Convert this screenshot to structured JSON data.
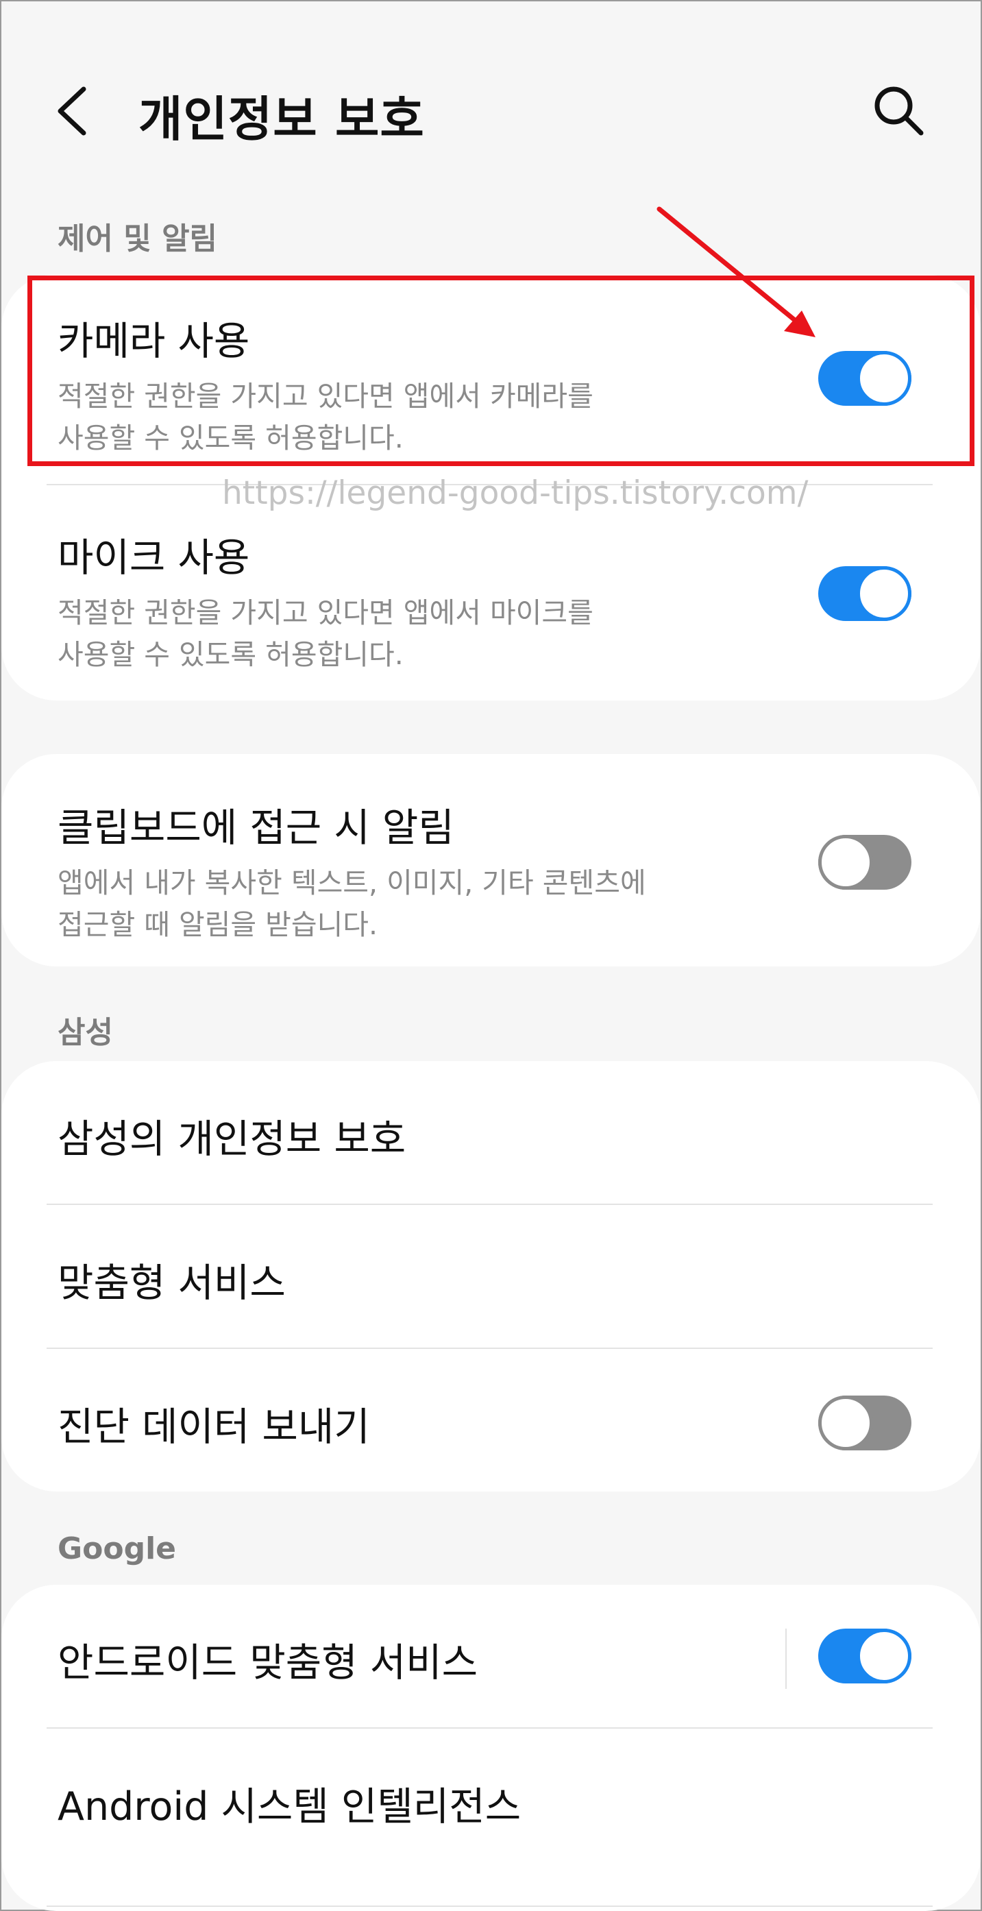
{
  "header": {
    "title": "개인정보 보호",
    "back_icon": "chevron-left-icon",
    "search_icon": "search-icon"
  },
  "sections": {
    "control": {
      "label": "제어 및 알림"
    },
    "samsung": {
      "label": "삼성"
    },
    "google": {
      "label": "Google"
    }
  },
  "items": {
    "camera": {
      "title": "카메라 사용",
      "desc_line1": "적절한 권한을 가지고 있다면 앱에서 카메라를",
      "desc_line2": "사용할 수 있도록 허용합니다.",
      "enabled": true
    },
    "mic": {
      "title": "마이크 사용",
      "desc_line1": "적절한 권한을 가지고 있다면 앱에서 마이크를",
      "desc_line2": "사용할 수 있도록 허용합니다.",
      "enabled": true
    },
    "clipboard": {
      "title": "클립보드에 접근 시 알림",
      "desc_line1": "앱에서 내가 복사한 텍스트, 이미지, 기타 콘텐츠에",
      "desc_line2": "접근할 때 알림을 받습니다.",
      "enabled": false
    },
    "samsung_privacy": {
      "title": "삼성의 개인정보 보호"
    },
    "custom_service": {
      "title": "맞춤형 서비스"
    },
    "diagnostic": {
      "title": "진단 데이터 보내기",
      "enabled": false
    },
    "android_custom": {
      "title": "안드로이드 맞춤형 서비스",
      "enabled": true
    },
    "android_intelligence": {
      "title": "Android 시스템 인텔리전스"
    }
  },
  "annotation": {
    "highlight_color": "#e8141b",
    "watermark": "https://legend-good-tips.tistory.com/"
  },
  "colors": {
    "toggle_on": "#1a87f0",
    "toggle_off": "#8d8d8d"
  }
}
